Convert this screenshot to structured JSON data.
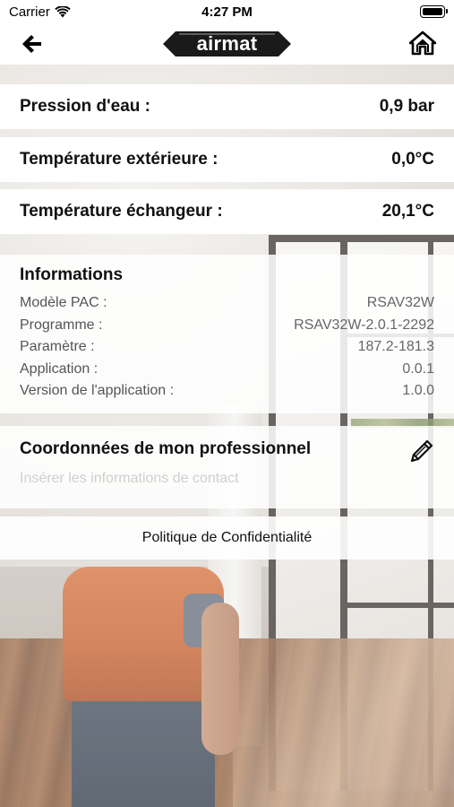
{
  "status_bar": {
    "carrier": "Carrier",
    "time": "4:27 PM",
    "wifi_icon": "wifi-icon",
    "battery_icon": "battery-icon"
  },
  "nav": {
    "back_icon": "arrow-left-icon",
    "home_icon": "home-icon",
    "logo_text": "airmat"
  },
  "readings": {
    "pressure": {
      "label": "Pression d'eau :",
      "value": "0,9 bar"
    },
    "outdoor_temp": {
      "label": "Température extérieure :",
      "value": "0,0°C"
    },
    "exchanger_temp": {
      "label": "Température échangeur :",
      "value": "20,1°C"
    }
  },
  "informations": {
    "title": "Informations",
    "items": [
      {
        "key": "Modèle PAC :",
        "value": "RSAV32W"
      },
      {
        "key": "Programme :",
        "value": "RSAV32W-2.0.1-2292"
      },
      {
        "key": "Paramètre :",
        "value": "187.2-181.3"
      },
      {
        "key": "Application :",
        "value": "0.0.1"
      },
      {
        "key": "Version de l'application :",
        "value": "1.0.0"
      }
    ]
  },
  "contact": {
    "title": "Coordonnées de mon professionnel",
    "placeholder": "Insérer les informations de contact",
    "edit_icon": "pencil-icon"
  },
  "privacy": {
    "label": "Politique de Confidentialité"
  },
  "colors": {
    "logo_bg": "#1a1a1a",
    "text_primary": "#111111",
    "text_secondary": "#555555",
    "placeholder": "#cfcfcf"
  }
}
